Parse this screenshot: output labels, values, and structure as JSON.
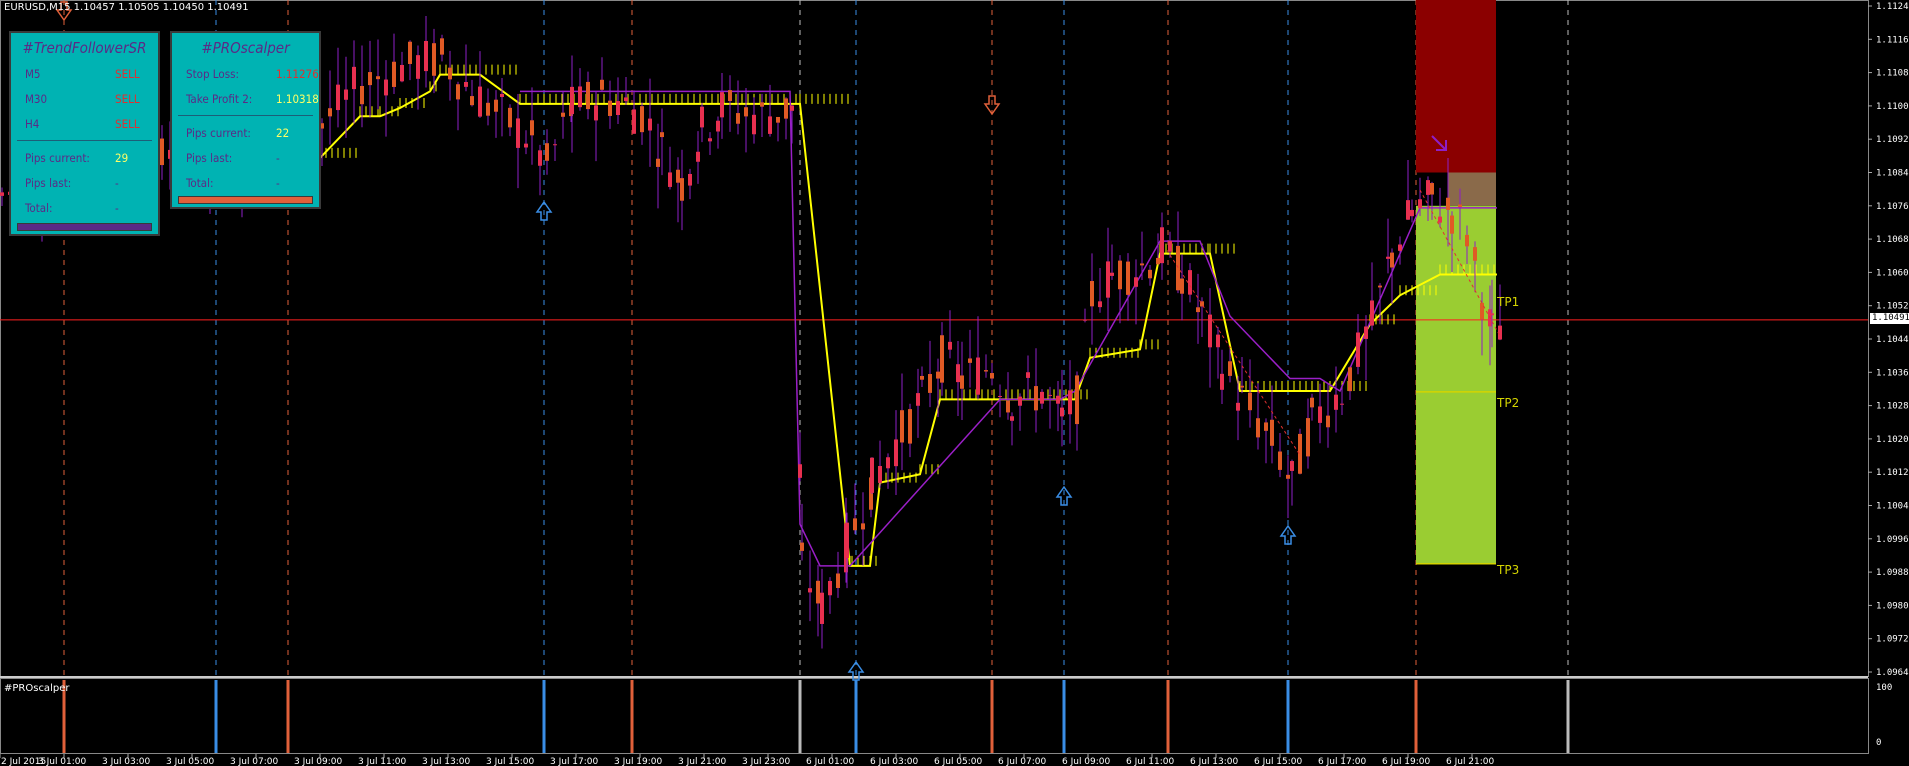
{
  "header": {
    "symbol_info": "EURUSD,M15  1.10457 1.10505 1.10450 1.10491"
  },
  "subwindow": {
    "title": "#PROscalper",
    "scale_top": "100",
    "scale_bottom": "0"
  },
  "panels": {
    "trend": {
      "title": "#TrendFollowerSR",
      "rows": [
        {
          "label": "M5",
          "value": "SELL"
        },
        {
          "label": "M30",
          "value": "SELL"
        },
        {
          "label": "H4",
          "value": "SELL"
        }
      ],
      "stats": [
        {
          "label": "Pips current:",
          "value": "29"
        },
        {
          "label": "Pips last:",
          "value": "-"
        },
        {
          "label": "Total:",
          "value": "-"
        }
      ],
      "bar_color": "#5b2a86"
    },
    "scalper": {
      "title": "#PROscalper",
      "rows": [
        {
          "label": "Stop Loss:",
          "value": "1.11276"
        },
        {
          "label": "Take Profit 2:",
          "value": "1.10318"
        }
      ],
      "stats": [
        {
          "label": "Pips current:",
          "value": "22"
        },
        {
          "label": "Pips last:",
          "value": "-"
        },
        {
          "label": "Total:",
          "value": "-"
        }
      ],
      "bar_color": "#e0603a"
    }
  },
  "targets": {
    "tp1": "TP1",
    "tp2": "TP2",
    "tp3": "TP3"
  },
  "colors": {
    "bull": "#e8304f",
    "bear": "#e05a25",
    "wick": "#8e1fc7",
    "trend": "#ffff00",
    "stop_line": "#9a1fc7",
    "sell_zone": "#8b0000",
    "target_zone": "#9acd32",
    "current_price_line": "#ff2020",
    "vline_blue": "#3a8ee6",
    "vline_red": "#e0603a",
    "vline_white": "#bbbbbb"
  },
  "chart_data": {
    "type": "candlestick",
    "symbol": "EURUSD",
    "timeframe": "M15",
    "ohlc_current": {
      "open": 1.10457,
      "high": 1.10505,
      "low": 1.1045,
      "close": 1.10491
    },
    "current_price": "1.10491",
    "y_ticks": [
      "1.11245",
      "1.11165",
      "1.11085",
      "1.11005",
      "1.10925",
      "1.10845",
      "1.10765",
      "1.10685",
      "1.10605",
      "1.10525",
      "1.10445",
      "1.10365",
      "1.10285",
      "1.10205",
      "1.10125",
      "1.10045",
      "1.09965",
      "1.09885",
      "1.09805",
      "1.09725",
      "1.09645"
    ],
    "x_ticks": [
      "2 Jul 2015",
      "3 Jul 01:00",
      "3 Jul 03:00",
      "3 Jul 05:00",
      "3 Jul 07:00",
      "3 Jul 09:00",
      "3 Jul 11:00",
      "3 Jul 13:00",
      "3 Jul 15:00",
      "3 Jul 17:00",
      "3 Jul 19:00",
      "3 Jul 21:00",
      "3 Jul 23:00",
      "6 Jul 01:00",
      "6 Jul 03:00",
      "6 Jul 05:00",
      "6 Jul 07:00",
      "6 Jul 09:00",
      "6 Jul 11:00",
      "6 Jul 13:00",
      "6 Jul 15:00",
      "6 Jul 17:00",
      "6 Jul 19:00",
      "6 Jul 21:00"
    ],
    "ylim": [
      1.09645,
      1.11245
    ],
    "stop_loss": 1.11276,
    "take_profit_2": 1.10318
  }
}
